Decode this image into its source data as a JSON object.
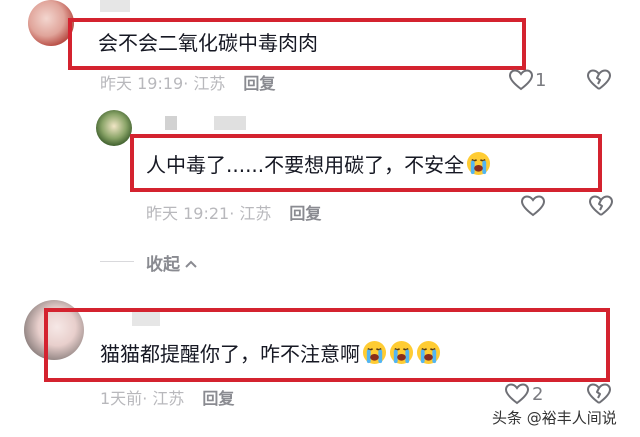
{
  "comments": [
    {
      "text": "会不会二氧化碳中毒肉肉",
      "meta_time": "昨天 19:19",
      "meta_location": "· 江苏",
      "reply_label": "回复",
      "like_count": "1"
    },
    {
      "text": "人中毒了......不要想用碳了，不安全",
      "meta_time": "昨天 19:21",
      "meta_location": "· 江苏",
      "reply_label": "回复",
      "emoji": "loudly-crying-face"
    },
    {
      "text": "猫猫都提醒你了，咋不注意啊",
      "meta_time": "1天前",
      "meta_location": "· 江苏",
      "reply_label": "回复",
      "like_count": "2",
      "emoji_count": 3,
      "emoji": "loudly-crying-face"
    }
  ],
  "collapse_label": "收起",
  "watermark": {
    "prefix": "头条",
    "handle": "@裕丰人间说"
  },
  "colors": {
    "highlight_border": "#d4232f",
    "meta_text": "#b8b8bc",
    "reply_text": "#8a8b91"
  },
  "icons": [
    "heart-outline-icon",
    "broken-heart-icon",
    "chevron-up-icon",
    "loudly-crying-face-emoji"
  ]
}
